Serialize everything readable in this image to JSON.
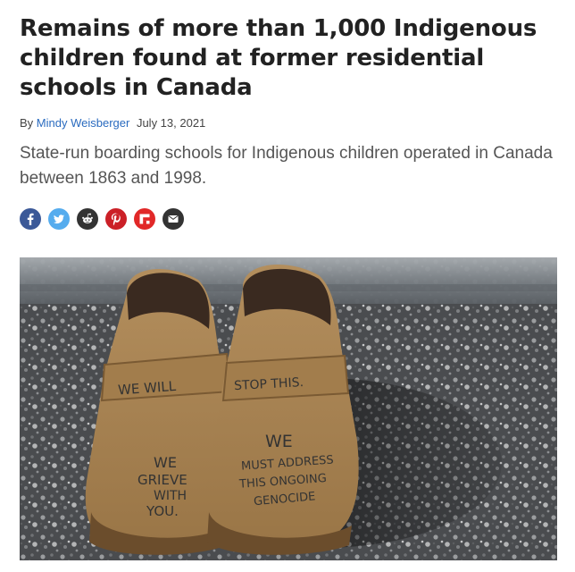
{
  "article": {
    "headline": "Remains of more than 1,000 Indigenous children found at former residential schools in Canada",
    "byline_prefix": "By",
    "author": "Mindy Weisberger",
    "date": "July 13, 2021",
    "subtitle": "State-run boarding schools for Indigenous children operated in Canada between 1863 and 1998."
  },
  "share": [
    {
      "name": "facebook-icon",
      "color": "#3b5998"
    },
    {
      "name": "twitter-icon",
      "color": "#55acee"
    },
    {
      "name": "reddit-icon",
      "color": "#333333"
    },
    {
      "name": "pinterest-icon",
      "color": "#cb2027"
    },
    {
      "name": "flipboard-icon",
      "color": "#e12828"
    },
    {
      "name": "email-icon",
      "color": "#333333"
    }
  ],
  "hero_image": {
    "shoe_left_text": [
      "WE WILL",
      "WE",
      "GRIEVE",
      "WITH",
      "YOU."
    ],
    "shoe_right_text": [
      "STOP THIS.",
      "WE",
      "MUST ADDRESS",
      "THIS ONGOING",
      "GENOCIDE"
    ]
  }
}
